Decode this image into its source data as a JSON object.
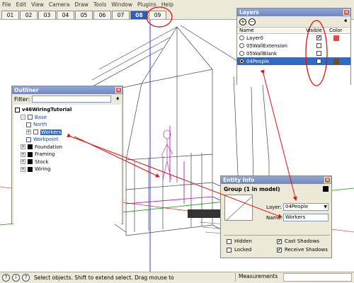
{
  "menu": [
    "File",
    "Edit",
    "View",
    "Camera",
    "Draw",
    "Tools",
    "Window",
    "Plugins",
    "Help"
  ],
  "scene_tabs": [
    "01",
    "02",
    "03",
    "04",
    "05",
    "06",
    "07",
    "08",
    "09"
  ],
  "active_tab": "08",
  "layers": {
    "title": "Layers",
    "headers": {
      "name": "Name",
      "visible": "Visible",
      "color": "Color"
    },
    "rows": [
      {
        "name": "Layer0",
        "visible": true,
        "color": "#ee4444",
        "selected": false,
        "active": false
      },
      {
        "name": "05WallExtension",
        "visible": false,
        "color": "",
        "selected": false,
        "active": false
      },
      {
        "name": "05WallBlank",
        "visible": false,
        "color": "",
        "selected": false,
        "active": false
      },
      {
        "name": "04People",
        "visible": true,
        "color": "#7a4a1c",
        "selected": true,
        "active": true
      }
    ]
  },
  "outliner": {
    "title": "Outliner",
    "filter_label": "Filter:",
    "filter_value": "",
    "tree": [
      {
        "label": "v46WiringTutorial",
        "depth": 0,
        "expander": "",
        "icon": "model",
        "style": "bold"
      },
      {
        "label": "Base",
        "depth": 1,
        "expander": "-",
        "icon": "group",
        "style": "blue"
      },
      {
        "label": "North",
        "depth": 2,
        "expander": "",
        "icon": "group",
        "style": "blue"
      },
      {
        "label": "Workers",
        "depth": 2,
        "expander": "+",
        "icon": "group",
        "style": "highlight"
      },
      {
        "label": "Workpoint",
        "depth": 2,
        "expander": "",
        "icon": "group",
        "style": "blue"
      },
      {
        "label": "Foundation",
        "depth": 1,
        "expander": "+",
        "icon": "component",
        "style": ""
      },
      {
        "label": "Framing",
        "depth": 1,
        "expander": "+",
        "icon": "component",
        "style": ""
      },
      {
        "label": "Stock",
        "depth": 1,
        "expander": "+",
        "icon": "component",
        "style": ""
      },
      {
        "label": "Wiring",
        "depth": 1,
        "expander": "+",
        "icon": "component",
        "style": ""
      }
    ]
  },
  "entity": {
    "title": "Entity Info",
    "heading": "Group (1 in model)",
    "layer_label": "Layer:",
    "layer_value": "04People",
    "name_label": "Name:",
    "name_value": "Workers",
    "hidden_label": "Hidden",
    "locked_label": "Locked",
    "cast_label": "Cast Shadows",
    "receive_label": "Receive Shadows",
    "hidden": false,
    "locked": false,
    "cast": true,
    "receive": true
  },
  "status": {
    "icons": [
      "?",
      "i",
      "?"
    ],
    "text": "Select objects. Shift to extend select. Drag mouse to",
    "measurements_label": "Measurements"
  },
  "colors": {
    "annotation": "#e01010",
    "accent": "#316ac5",
    "axis_blue": "#0000ff",
    "axis_green": "#00a000"
  }
}
